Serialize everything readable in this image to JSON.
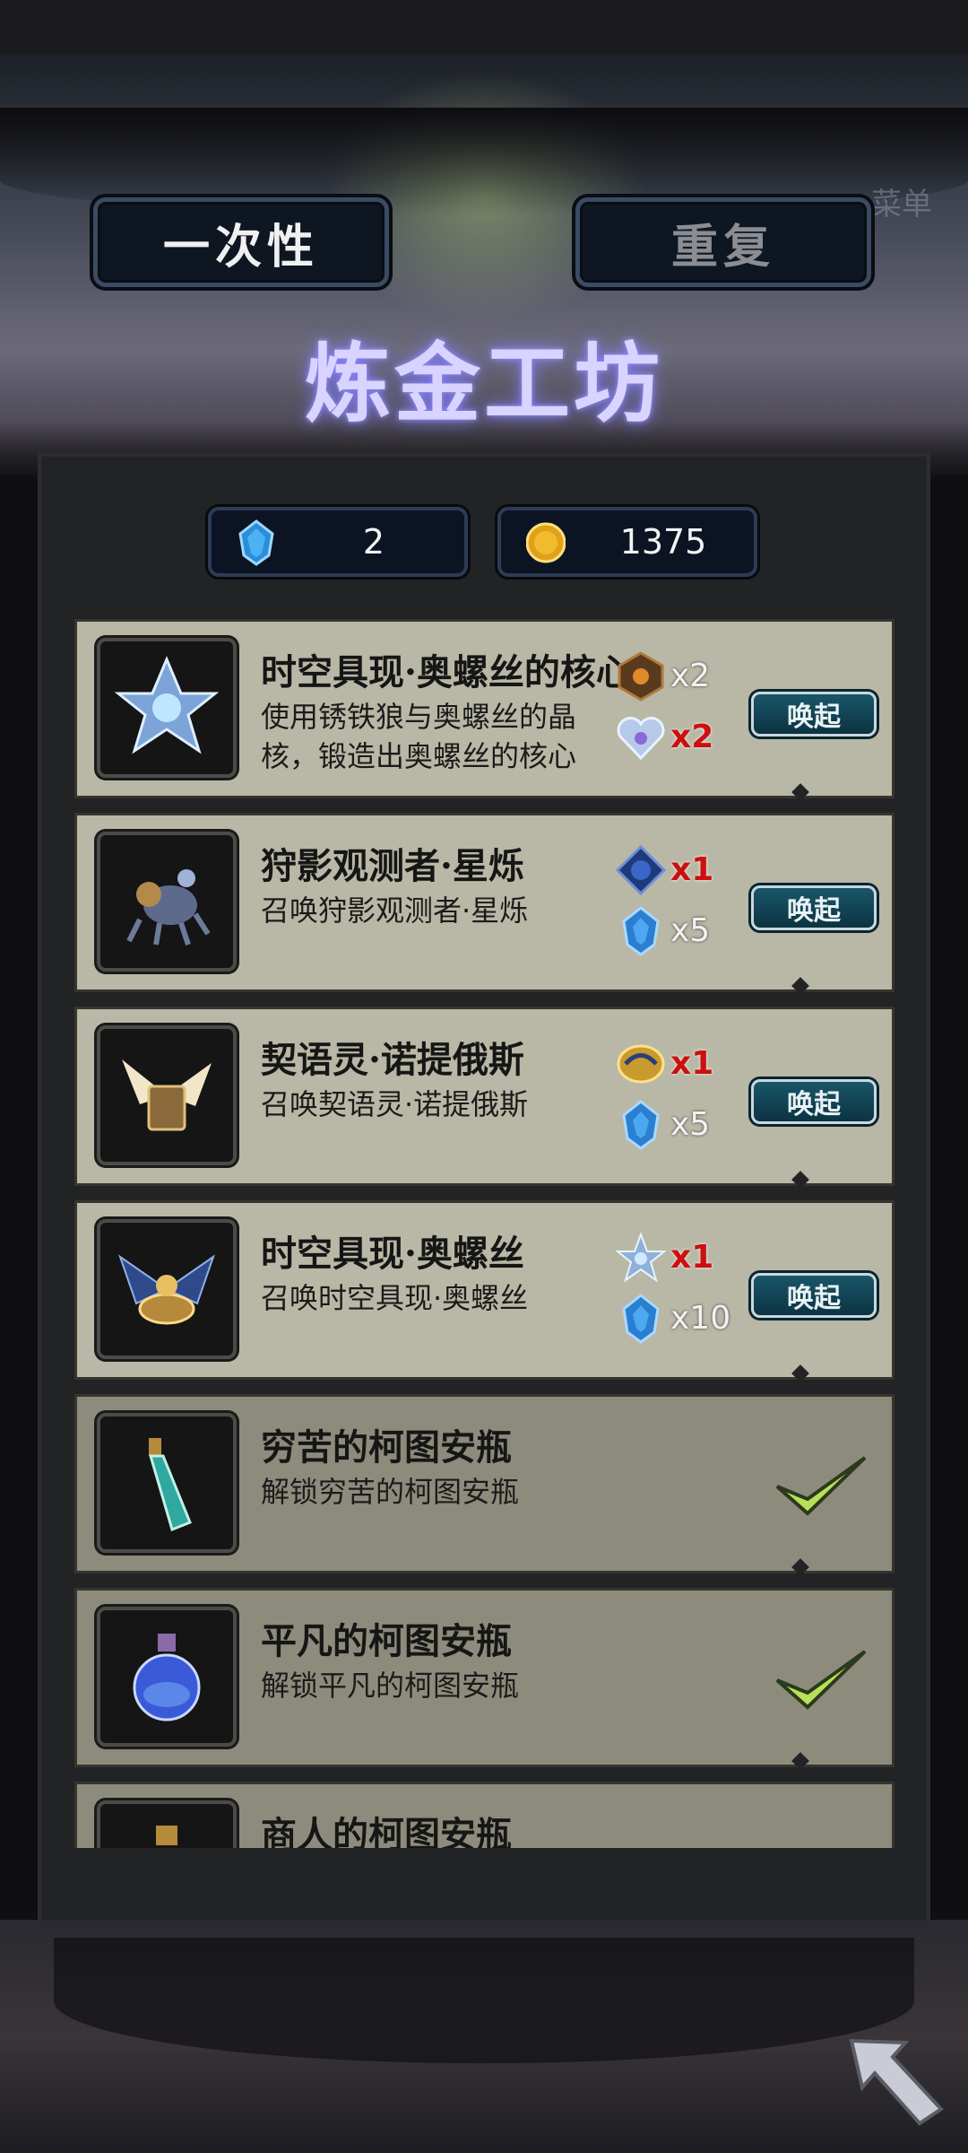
{
  "header": {
    "tab_one_time": "一次性",
    "tab_repeat": "重复",
    "title": "炼金工坊",
    "menu_hint": "菜单"
  },
  "currency": {
    "gems": "2",
    "coins": "1375"
  },
  "recipes": [
    {
      "name": "时空具现·奥螺丝的核心",
      "desc": "使用锈铁狼与奥螺丝的晶核，锻造出奥螺丝的核心",
      "requirements": [
        {
          "icon": "rusty-crystal-icon",
          "count": "x2",
          "insufficient": false
        },
        {
          "icon": "heart-crystal-icon",
          "count": "x2",
          "insufficient": true
        }
      ],
      "action": "唤起"
    },
    {
      "name": "狩影观测者·星烁",
      "desc": "召唤狩影观测者·星烁",
      "requirements": [
        {
          "icon": "blue-orb-icon",
          "count": "x1",
          "insufficient": true
        },
        {
          "icon": "blue-gem-icon",
          "count": "x5",
          "insufficient": false
        }
      ],
      "action": "唤起"
    },
    {
      "name": "契语灵·诺提俄斯",
      "desc": "召唤契语灵·诺提俄斯",
      "requirements": [
        {
          "icon": "golden-shell-icon",
          "count": "x1",
          "insufficient": true
        },
        {
          "icon": "blue-gem-icon",
          "count": "x5",
          "insufficient": false
        }
      ],
      "action": "唤起"
    },
    {
      "name": "时空具现·奥螺丝",
      "desc": "召唤时空具现·奥螺丝",
      "requirements": [
        {
          "icon": "star-core-icon",
          "count": "x1",
          "insufficient": true
        },
        {
          "icon": "blue-gem-icon",
          "count": "x10",
          "insufficient": false
        }
      ],
      "action": "唤起"
    },
    {
      "name": "穷苦的柯图安瓶",
      "desc": "解锁穷苦的柯图安瓶",
      "completed": true
    },
    {
      "name": "平凡的柯图安瓶",
      "desc": "解锁平凡的柯图安瓶",
      "completed": true
    },
    {
      "name": "商人的柯图安瓶",
      "desc": "",
      "completed": false
    }
  ],
  "colors": {
    "title_glow": "#7f7cff",
    "card_bg": "#b9b8a6",
    "card_done_bg": "#8d8c7c",
    "insufficient": "#cc1010",
    "summon_button": "#195669",
    "check": "#b7e05a"
  }
}
